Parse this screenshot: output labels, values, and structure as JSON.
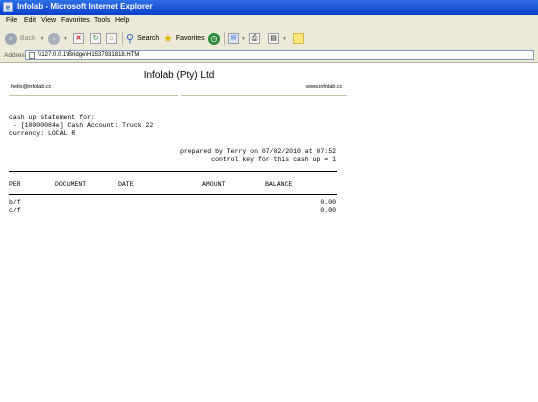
{
  "window": {
    "title": "Infolab - Microsoft Internet Explorer"
  },
  "menu": [
    "File",
    "Edit",
    "View",
    "Favorites",
    "Tools",
    "Help"
  ],
  "toolbar": {
    "back": "Back",
    "search": "Search",
    "favorites": "Favorites"
  },
  "address": {
    "label": "Address",
    "url": "\\\\127.0.0.1\\Bridge\\H1537931818.HTM"
  },
  "report": {
    "company": "Infolab (Pty) Ltd",
    "email": "hello@infolab.cc",
    "website": "www.infolab.cc",
    "statement_line1": "cash up statement for:",
    "statement_line2": " - [10000084e] Cash Account: Truck 22",
    "statement_line3": "currency: LOCAL R",
    "prepared_by": "prepared by Terry on 07/02/2010 at 07:52",
    "control_key": "control key for this cash up = 1",
    "columns": [
      "PER",
      "DOCUMENT",
      "DATE",
      "AMOUNT",
      "BALANCE"
    ],
    "rows": [
      {
        "per": "b/f",
        "balance": "0.00"
      },
      {
        "per": "c/f",
        "balance": "0.00"
      }
    ]
  }
}
